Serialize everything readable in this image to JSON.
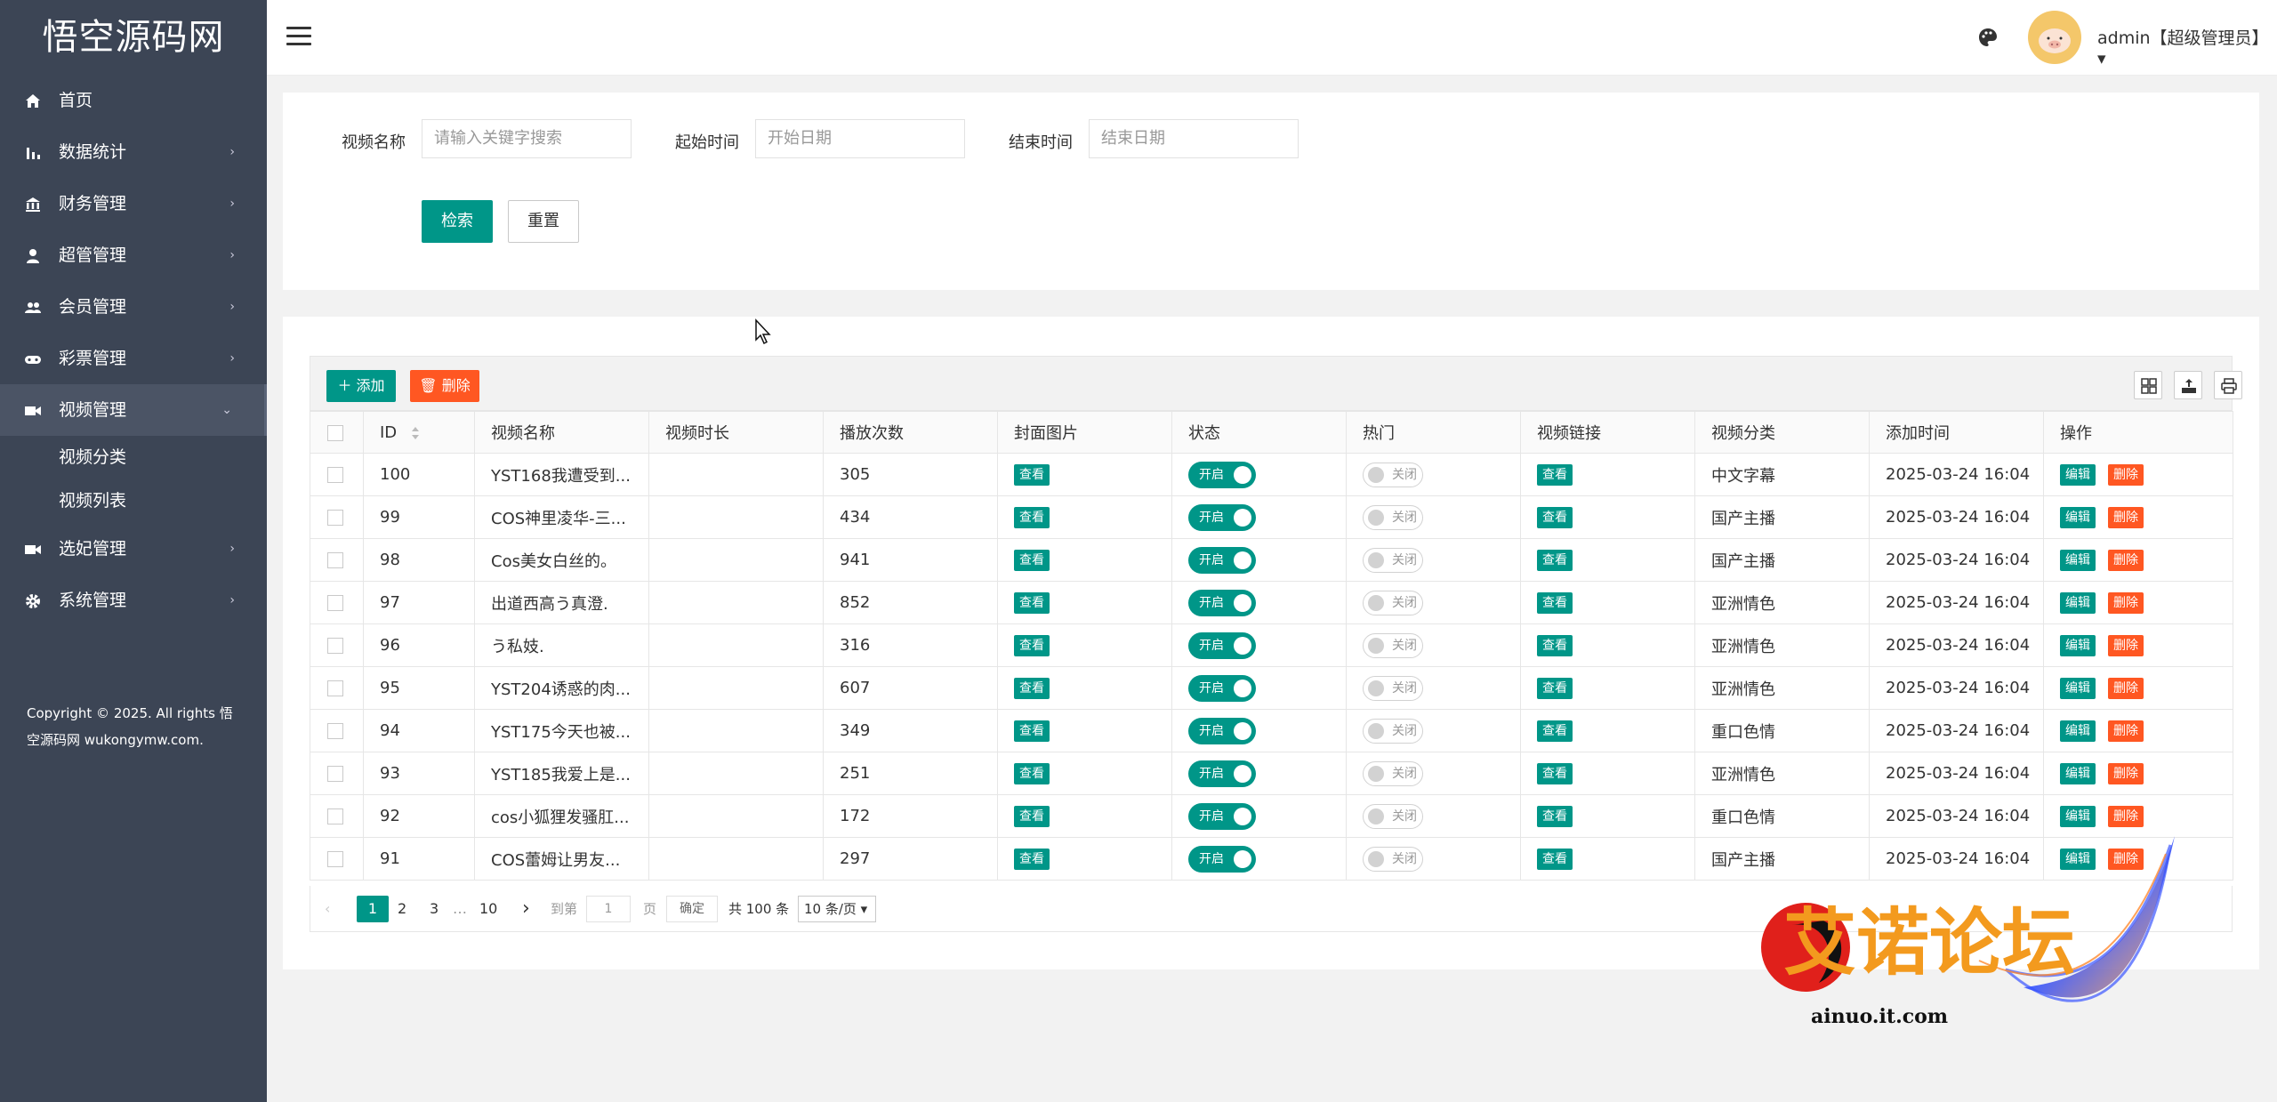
{
  "brand": {
    "logo": "悟空源码网"
  },
  "sidebar": {
    "items": [
      {
        "label": "首页",
        "icon": "home-icon",
        "arrow": ""
      },
      {
        "label": "数据统计",
        "icon": "bar-chart-icon",
        "arrow": "›"
      },
      {
        "label": "财务管理",
        "icon": "bank-icon",
        "arrow": "›"
      },
      {
        "label": "超管管理",
        "icon": "user-icon",
        "arrow": "›"
      },
      {
        "label": "会员管理",
        "icon": "users-icon",
        "arrow": "›"
      },
      {
        "label": "彩票管理",
        "icon": "gamepad-icon",
        "arrow": "›"
      },
      {
        "label": "视频管理",
        "icon": "video-icon",
        "arrow": "›"
      },
      {
        "label": "选妃管理",
        "icon": "video-icon",
        "arrow": "›"
      },
      {
        "label": "系统管理",
        "icon": "gear-icon",
        "arrow": "›"
      }
    ],
    "sub_items": [
      {
        "label": "视频分类"
      },
      {
        "label": "视频列表"
      }
    ],
    "copyright": "Copyright © 2025. All rights 悟空源码网 wukongymw.com."
  },
  "header": {
    "user": "admin【超级管理员】▾",
    "icons": [
      "menu-toggle-icon",
      "palette-icon"
    ]
  },
  "search": {
    "name_label": "视频名称",
    "name_placeholder": "请输入关键字搜索",
    "start_label": "起始时间",
    "start_placeholder": "开始日期",
    "end_label": "结束时间",
    "end_placeholder": "结束日期",
    "search_btn": "检索",
    "reset_btn": "重置"
  },
  "toolbar": {
    "add_label": "添加",
    "delete_label": "删除",
    "tools": [
      "grid-icon",
      "export-icon",
      "print-icon"
    ]
  },
  "table": {
    "columns": [
      "ID",
      "视频名称",
      "视频时长",
      "播放次数",
      "封面图片",
      "状态",
      "热门",
      "视频链接",
      "视频分类",
      "添加时间",
      "操作"
    ],
    "view_label": "查看",
    "on_label": "开启",
    "off_label": "关闭",
    "edit_label": "编辑",
    "del_label": "删除",
    "rows": [
      {
        "id": "100",
        "name": "YST168我遭受到...",
        "duration": "",
        "plays": "305",
        "category": "中文字幕",
        "time": "2025-03-24 16:04"
      },
      {
        "id": "99",
        "name": "COS神里凌华-三...",
        "duration": "",
        "plays": "434",
        "category": "国产主播",
        "time": "2025-03-24 16:04"
      },
      {
        "id": "98",
        "name": "Cos美女白丝的。",
        "duration": "",
        "plays": "941",
        "category": "国产主播",
        "time": "2025-03-24 16:04"
      },
      {
        "id": "97",
        "name": "出道西高う真澄.",
        "duration": "",
        "plays": "852",
        "category": "亚洲情色",
        "time": "2025-03-24 16:04"
      },
      {
        "id": "96",
        "name": "う私妓.",
        "duration": "",
        "plays": "316",
        "category": "亚洲情色",
        "time": "2025-03-24 16:04"
      },
      {
        "id": "95",
        "name": "YST204诱惑的肉...",
        "duration": "",
        "plays": "607",
        "category": "亚洲情色",
        "time": "2025-03-24 16:04"
      },
      {
        "id": "94",
        "name": "YST175今天也被...",
        "duration": "",
        "plays": "349",
        "category": "重口色情",
        "time": "2025-03-24 16:04"
      },
      {
        "id": "93",
        "name": "YST185我爱上是...",
        "duration": "",
        "plays": "251",
        "category": "亚洲情色",
        "time": "2025-03-24 16:04"
      },
      {
        "id": "92",
        "name": "cos小狐狸发骚肛...",
        "duration": "",
        "plays": "172",
        "category": "重口色情",
        "time": "2025-03-24 16:04"
      },
      {
        "id": "91",
        "name": "COS蕾姆让男友...",
        "duration": "",
        "plays": "297",
        "category": "国产主播",
        "time": "2025-03-24 16:04"
      }
    ]
  },
  "pagination": {
    "prev": "‹",
    "pages": [
      "1",
      "2",
      "3",
      "…",
      "10"
    ],
    "next": "›",
    "goto_label": "到第",
    "goto_value": "1",
    "page_unit": "页",
    "confirm": "确定",
    "total": "共 100 条",
    "per_page": "10 条/页 ▾"
  },
  "watermark": {
    "brand_text": "艾诺论坛",
    "domain": "ainuo.it.com"
  },
  "colors": {
    "sidebar_bg": "#3c4555",
    "primary": "#009688",
    "danger": "#ff5722"
  }
}
